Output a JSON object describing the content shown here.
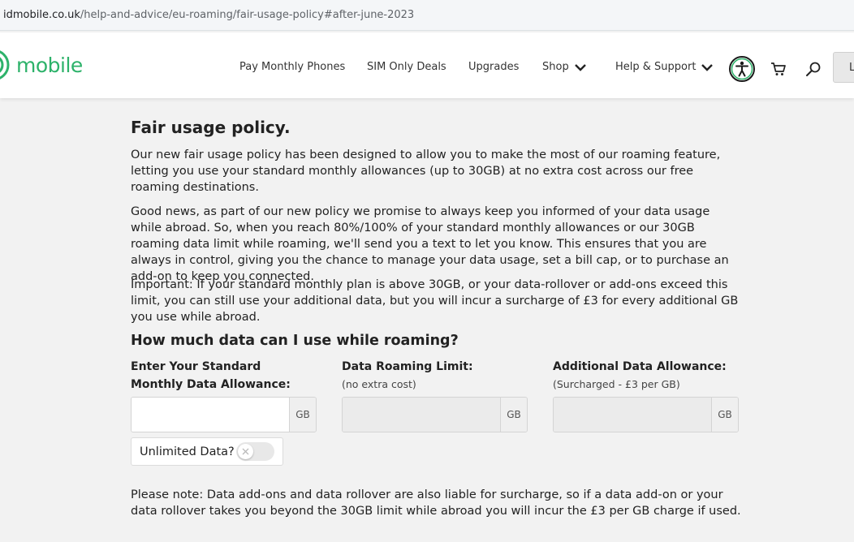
{
  "browser": {
    "url_domain": "idmobile.co.uk",
    "url_path": "/help-and-advice/eu-roaming/fair-usage-policy#after-june-2023"
  },
  "header": {
    "logo_text": "mobile",
    "brand_color": "#2db26a",
    "nav": [
      {
        "label": "Pay Monthly Phones"
      },
      {
        "label": "SIM Only Deals"
      },
      {
        "label": "Upgrades"
      },
      {
        "label": "Shop",
        "icon": "chevron-down-icon"
      },
      {
        "label": "Help & Support",
        "icon": "chevron-down-icon"
      }
    ],
    "icons": [
      "accessibility-icon",
      "cart-icon",
      "search-icon"
    ],
    "login_label": "L"
  },
  "main": {
    "title": "Fair usage policy.",
    "paragraphs": [
      "Our new fair usage policy has been designed to allow you to make the most of our roaming feature, letting you use your standard monthly allowances (up to 30GB) at no extra cost across our free roaming destinations.",
      "Good news, as part of our new policy we promise to always keep you informed of your data usage while abroad. So, when you reach 80%/100% of your standard monthly allowances or our 30GB roaming data limit while roaming, we'll send you a text to let you know. This ensures that you are always in control, giving you the chance to manage your data usage, set a bill cap, or to purchase an add-on to keep you connected.",
      "Important: If your standard monthly plan is above 30GB, or your data-rollover or add-ons exceed this limit, you can still use your additional data, but you will incur a surcharge of £3 for every additional GB you use while abroad."
    ],
    "calculator": {
      "heading": "How much data can I use while roaming?",
      "columns": [
        {
          "label": "Enter Your Standard Monthly Data Allowance:",
          "sublabel": "",
          "value": "",
          "unit": "GB"
        },
        {
          "label": "Data Roaming Limit:",
          "sublabel": "(no extra cost)",
          "value": "",
          "unit": "GB"
        },
        {
          "label": "Additional Data Allowance:",
          "sublabel": "(Surcharged - £3 per GB)",
          "value": "",
          "unit": "GB"
        }
      ],
      "unlimited_label": "Unlimited Data?",
      "unlimited_on": false
    },
    "note": "Please note: Data add-ons and data rollover are also liable for surcharge, so if a data add-on or your data rollover takes you beyond the 30GB limit while abroad you will incur the £3 per GB charge if used."
  }
}
